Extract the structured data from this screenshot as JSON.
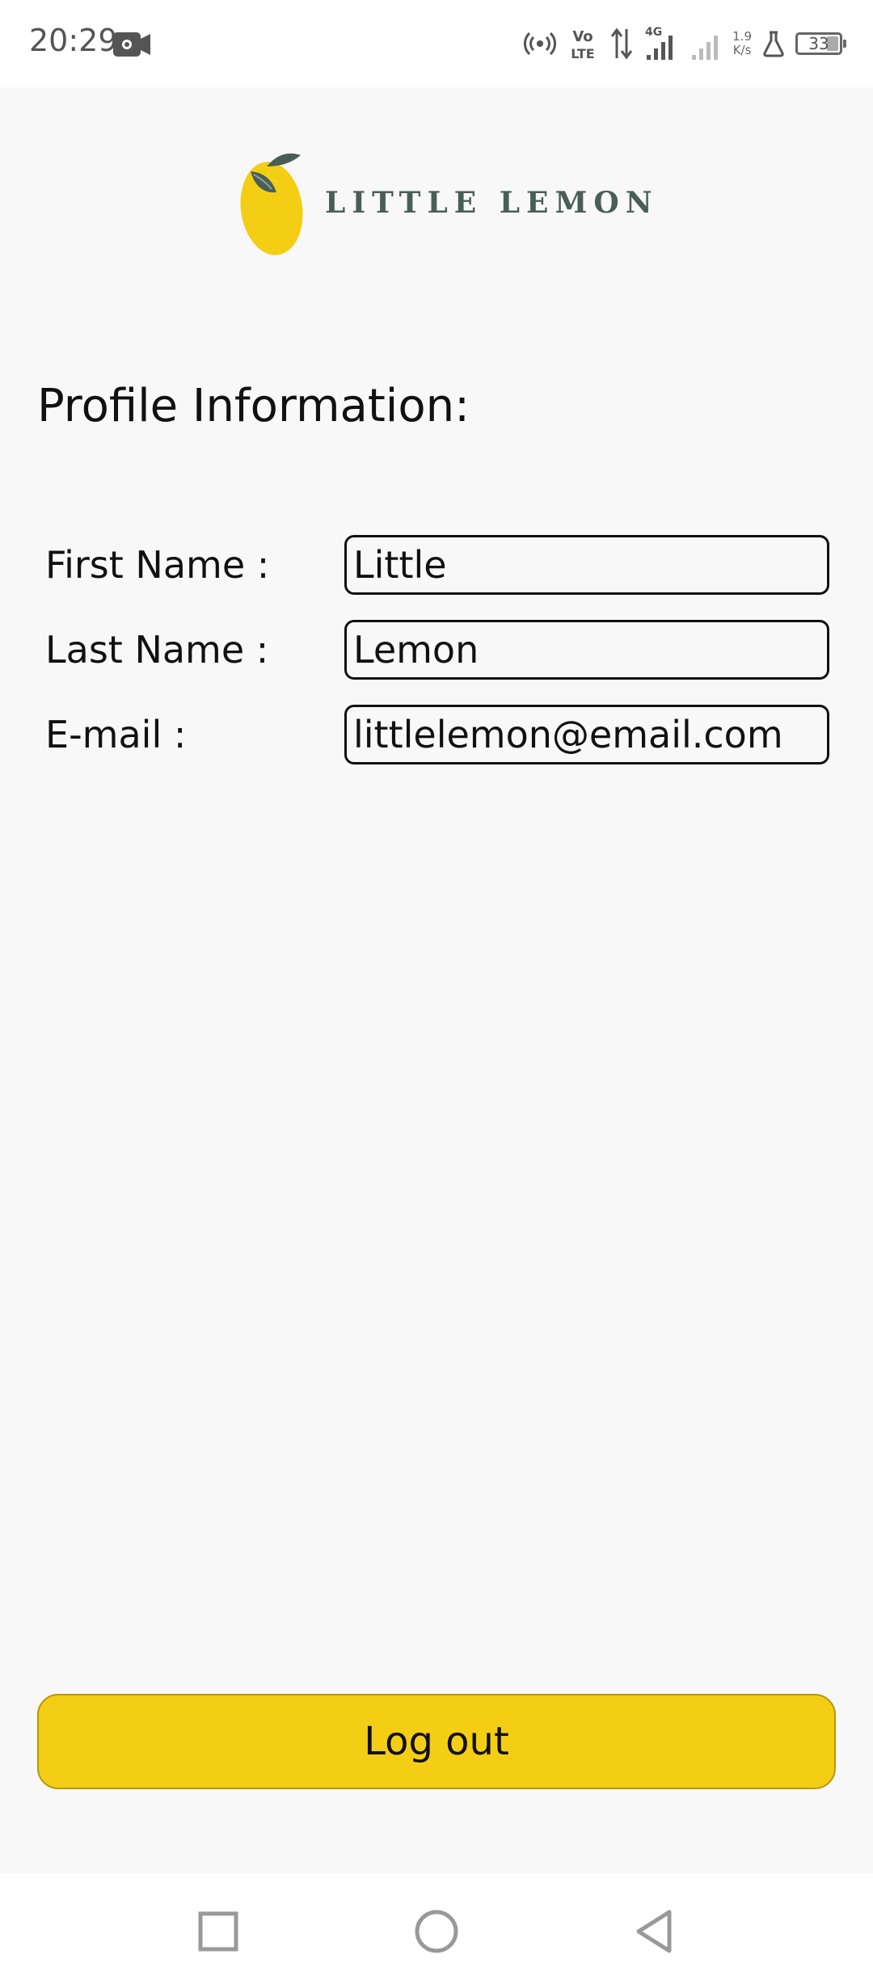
{
  "status_bar": {
    "time": "20:29",
    "net_speed_value": "1.9",
    "net_speed_unit": "K/s",
    "battery": "33"
  },
  "header": {
    "logo_text": "LITTLE LEMON"
  },
  "profile": {
    "title": "Profile Information:",
    "fields": [
      {
        "label": "First Name :",
        "value": "Little"
      },
      {
        "label": "Last Name :",
        "value": "Lemon"
      },
      {
        "label": "E-mail :",
        "value": "littlelemon@email.com"
      }
    ]
  },
  "actions": {
    "logout_label": "Log out"
  },
  "colors": {
    "accent_yellow": "#f4ce14",
    "brand_green": "#495e57",
    "background": "#f8f8f8"
  },
  "nav": {
    "icons": [
      "recent-apps-icon",
      "home-icon",
      "back-icon"
    ]
  }
}
